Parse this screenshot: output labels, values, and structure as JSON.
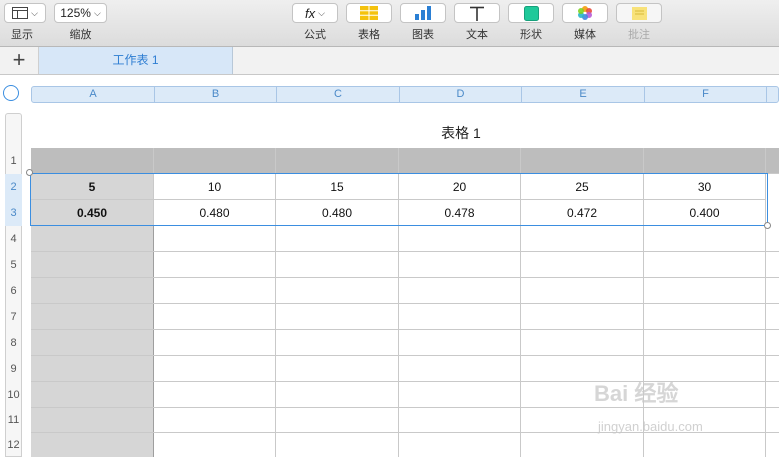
{
  "toolbar": {
    "view_label": "显示",
    "zoom_value": "125%",
    "zoom_label": "缩放",
    "formula_icon_text": "fx",
    "items": [
      "公式",
      "表格",
      "图表",
      "文本",
      "形状",
      "媒体",
      "批注"
    ]
  },
  "tabbar": {
    "add_symbol": "+",
    "sheet_name": "工作表 1"
  },
  "columns": [
    "A",
    "B",
    "C",
    "D",
    "E",
    "F"
  ],
  "rows": [
    "1",
    "2",
    "3",
    "4",
    "5",
    "6",
    "7",
    "8",
    "9",
    "10",
    "11",
    "12"
  ],
  "table": {
    "title": "表格 1",
    "row2": [
      "5",
      "10",
      "15",
      "20",
      "25",
      "30"
    ],
    "row3": [
      "0.450",
      "0.480",
      "0.480",
      "0.478",
      "0.472",
      "0.400"
    ]
  },
  "watermark": {
    "text": "Bai 经验",
    "url_text": "jingyan.baidu.com"
  },
  "colors": {
    "accent": "#3b8ee0",
    "header_gray": "#bdbdbd",
    "column_header_bg": "#dceaf8"
  }
}
